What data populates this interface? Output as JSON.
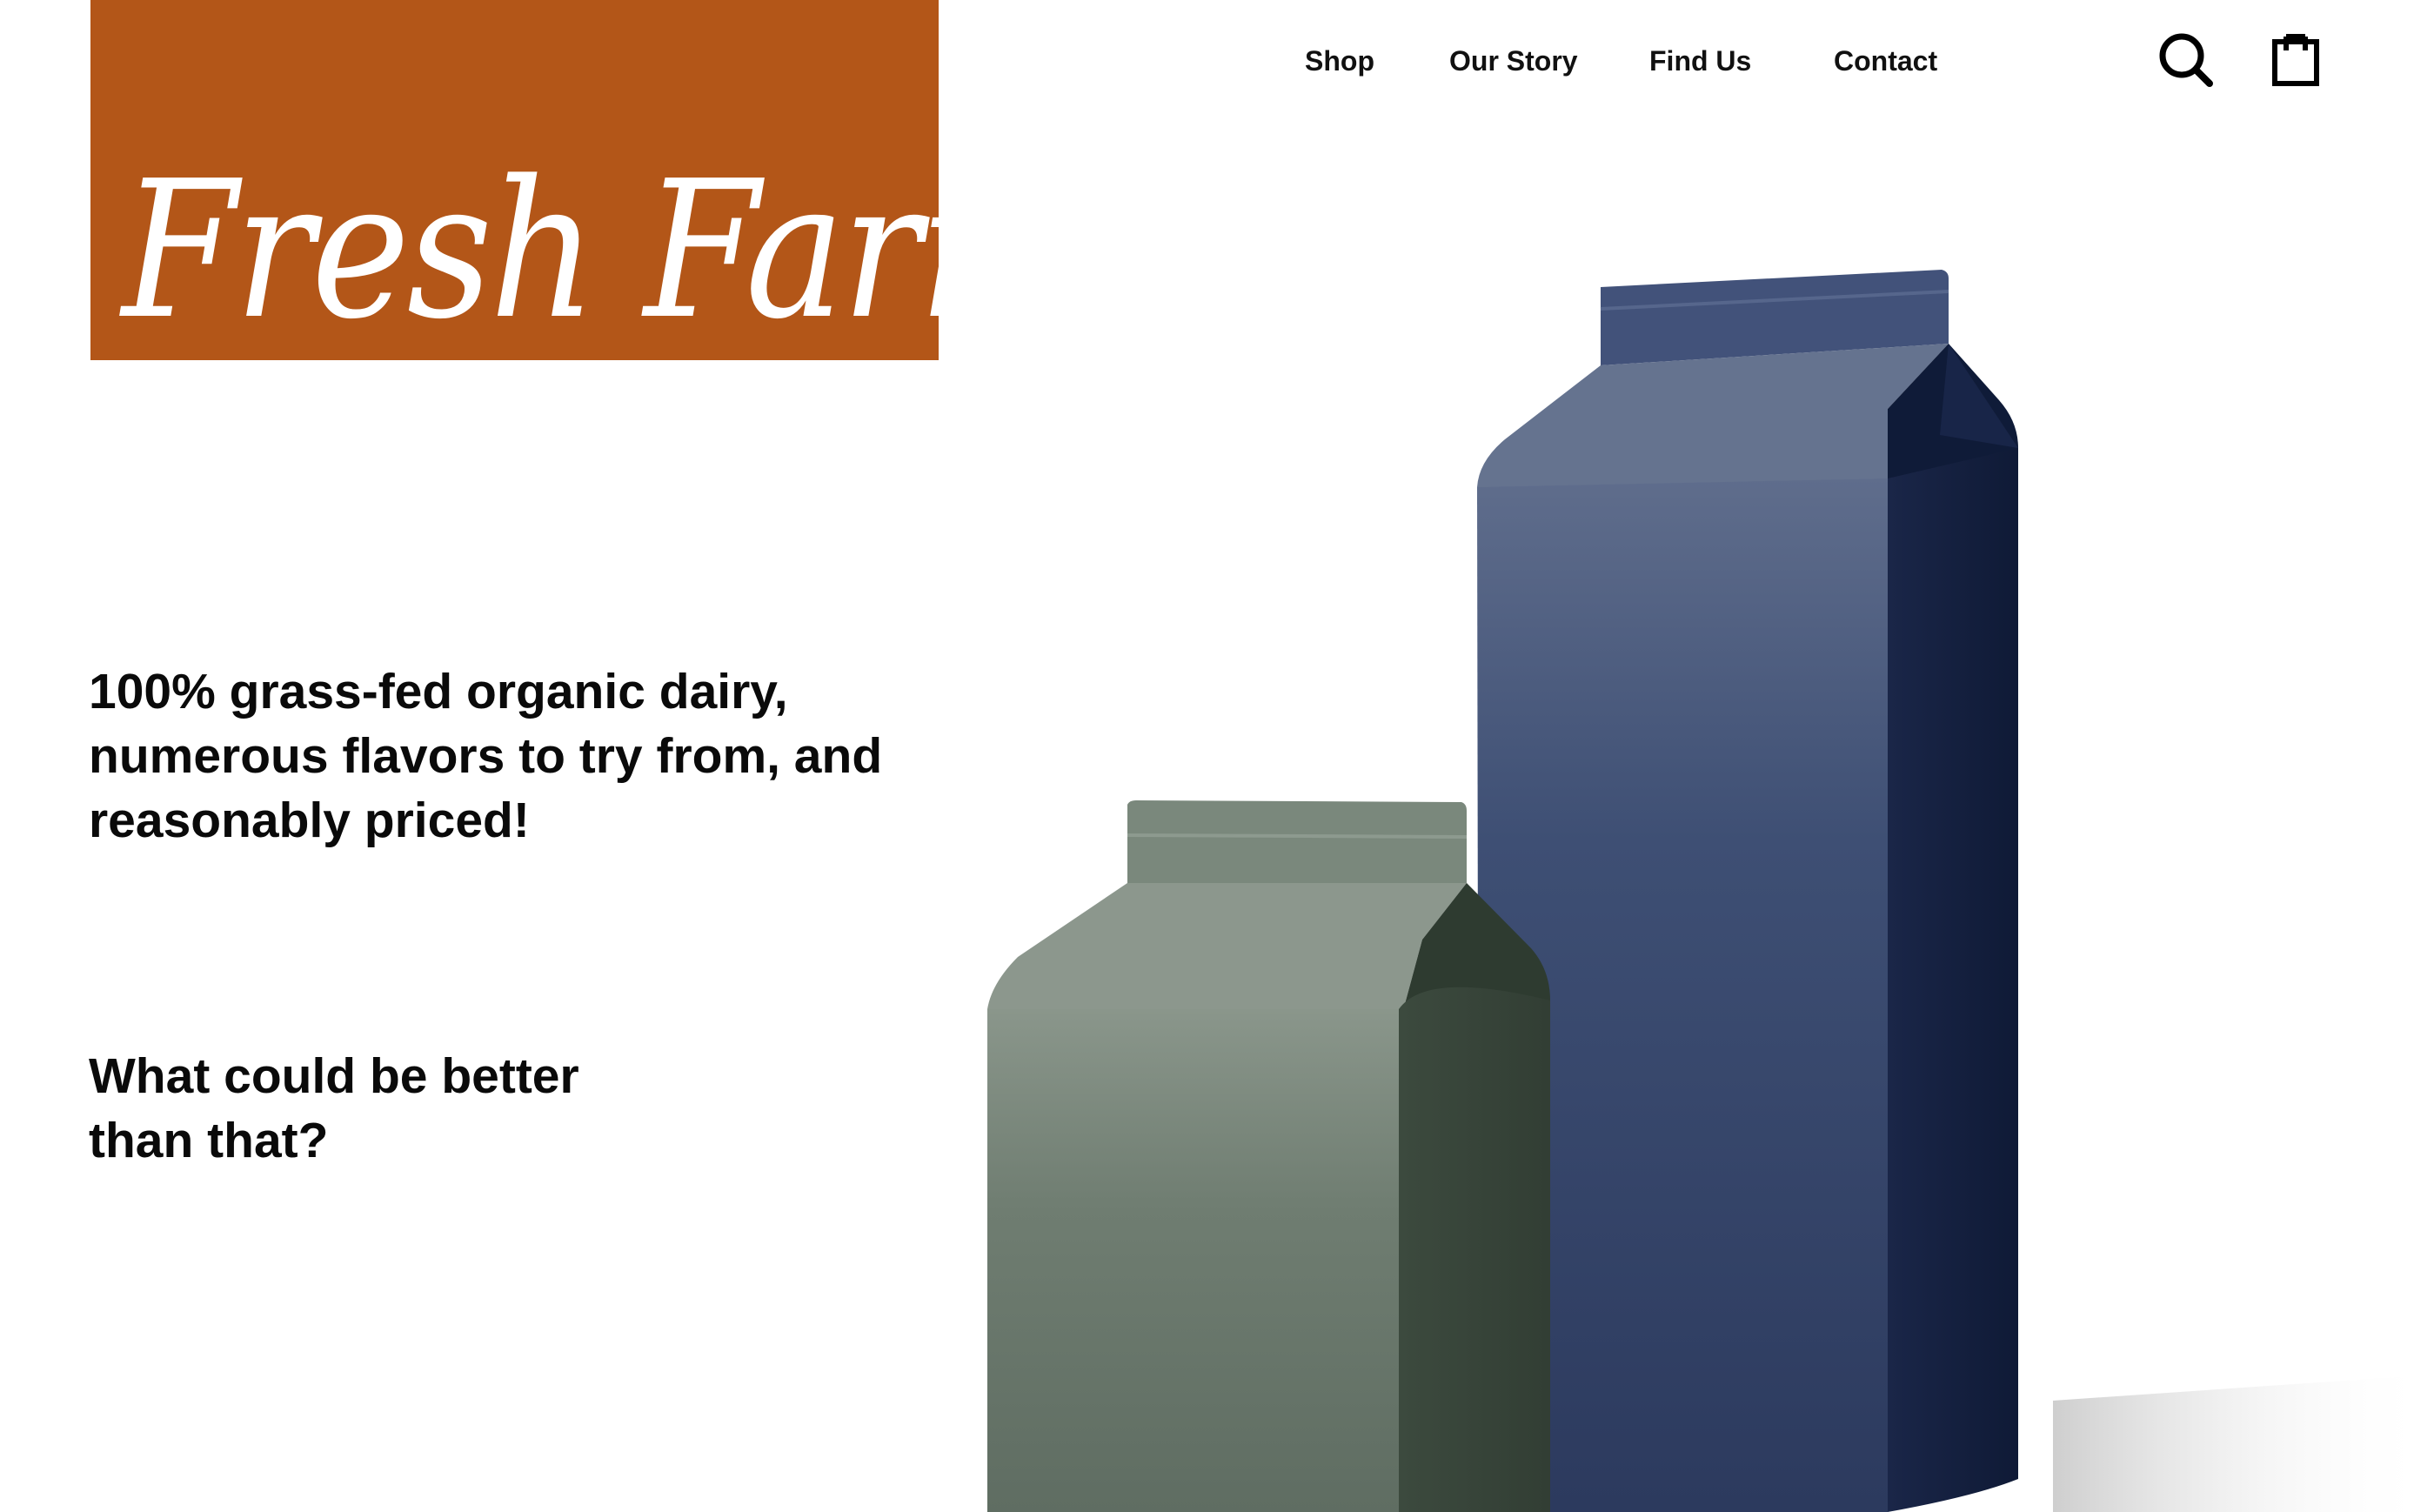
{
  "brand": {
    "name": "Fresh Farms",
    "accent_color": "#b35618"
  },
  "nav": {
    "items": [
      {
        "label": "Shop"
      },
      {
        "label": "Our Story"
      },
      {
        "label": "Find Us"
      },
      {
        "label": "Contact"
      }
    ]
  },
  "header_icons": {
    "search": "search-icon",
    "cart": "shopping-bag-icon"
  },
  "hero": {
    "tagline": "100% grass-fed organic dairy, numerous flavors to try from, and reasonably priced!",
    "question": "What could be better than that?",
    "image": {
      "subject": "two milk cartons",
      "carton_colors": [
        "#6f7f72",
        "#2d3e66"
      ]
    }
  }
}
